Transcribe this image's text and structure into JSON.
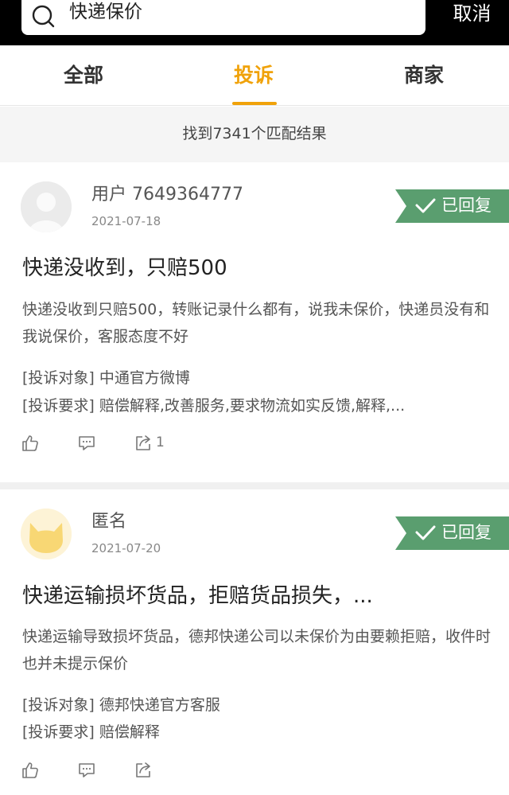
{
  "search": {
    "query": "快递保价",
    "cancel_label": "取消"
  },
  "tabs": [
    {
      "label": "全部"
    },
    {
      "label": "投诉"
    },
    {
      "label": "商家"
    }
  ],
  "active_tab": "投诉",
  "accent_color": "#f0a20a",
  "badge_color": "#5a9e6f",
  "result_text": "找到7341个匹配结果",
  "posts": [
    {
      "user": "用户 7649364777",
      "date": "2021-07-18",
      "badge": "已回复",
      "title": "快递没收到，只赔500",
      "description": "快递没收到只赔500，转账记录什么都有，说我未保价，快递员没有和我说保价，客服态度不好",
      "target": "[投诉对象] 中通官方微博",
      "demand": "[投诉要求] 赔偿解释,改善服务,要求物流如实反馈,解释,...",
      "share_count": "1"
    },
    {
      "user": "匿名",
      "date": "2021-07-20",
      "badge": "已回复",
      "title": "快递运输损坏货品，拒赔货品损失，...",
      "description": "快递运输导致损坏货品，德邦快递公司以未保价为由要赖拒赔，收件时也并未提示保价",
      "target": "[投诉对象] 德邦快递官方客服",
      "demand": "[投诉要求] 赔偿解释"
    }
  ]
}
